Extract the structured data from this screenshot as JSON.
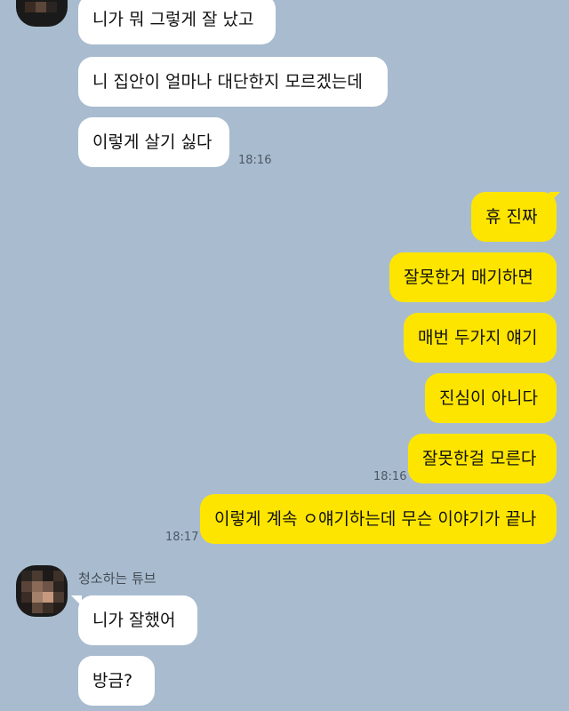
{
  "chat": {
    "peer_name": "청소하는 튜브",
    "messages_top": [
      {
        "text": "니가 뭐 그렇게 잘 났고"
      },
      {
        "text": "니 집안이 얼마나 대단한지 모르겠는데"
      },
      {
        "text": "이렇게 살기 싫다",
        "time": "18:16"
      }
    ],
    "messages_me": [
      {
        "text": "휴 진짜"
      },
      {
        "text": "잘못한거 매기하면"
      },
      {
        "text": "매번 두가지 얘기"
      },
      {
        "text": "진심이 아니다"
      },
      {
        "text": "잘못한걸 모른다",
        "time": "18:16"
      },
      {
        "text": "이렇게 계속 ㅇ얘기하는데 무슨 이야기가 끝나",
        "time": "18:17"
      }
    ],
    "messages_bottom": [
      {
        "text": "니가 잘했어"
      },
      {
        "text": "방금?"
      }
    ]
  },
  "colors": {
    "background": "#a9bccf",
    "my_bubble": "#fee500",
    "peer_bubble": "#ffffff"
  }
}
